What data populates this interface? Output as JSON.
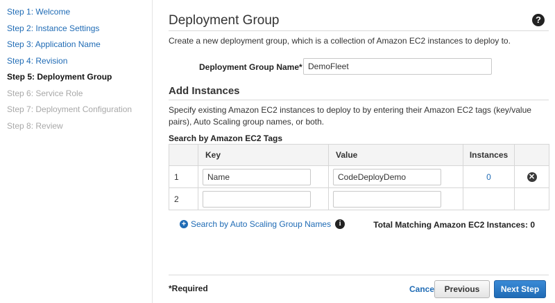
{
  "sidebar": {
    "steps": [
      {
        "label": "Step 1: Welcome"
      },
      {
        "label": "Step 2: Instance Settings"
      },
      {
        "label": "Step 3: Application Name"
      },
      {
        "label": "Step 4: Revision"
      },
      {
        "label": "Step 5: Deployment Group"
      },
      {
        "label": "Step 6: Service Role"
      },
      {
        "label": "Step 7: Deployment Configuration"
      },
      {
        "label": "Step 8: Review"
      }
    ]
  },
  "header": {
    "title": "Deployment Group",
    "help_icon": "question-circle-icon",
    "help_glyph": "?"
  },
  "intro": "Create a new deployment group, which is a collection of Amazon EC2 instances to deploy to.",
  "deployment_group": {
    "label": "Deployment Group Name*",
    "value": "DemoFleet"
  },
  "add_instances": {
    "title": "Add Instances",
    "description": "Specify existing Amazon EC2 instances to deploy to by entering their Amazon EC2 tags (key/value pairs), Auto Scaling group names, or both.",
    "tags_label": "Search by Amazon EC2 Tags",
    "table": {
      "columns": [
        "",
        "Key",
        "Value",
        "Instances",
        ""
      ],
      "rows": [
        {
          "num": "1",
          "key": "Name",
          "value": "CodeDeployDemo",
          "instances": "0",
          "remove_glyph": "✕"
        },
        {
          "num": "2",
          "key": "",
          "value": "",
          "instances": ""
        }
      ]
    },
    "asg_link": "Search by Auto Scaling Group Names",
    "plus_glyph": "+",
    "info_glyph": "i",
    "total": "Total Matching Amazon EC2 Instances: 0"
  },
  "footer": {
    "required": "*Required",
    "cancel": "Cancel",
    "previous": "Previous",
    "next": "Next Step"
  },
  "colors": {
    "link": "#1f6bb5",
    "primary_button": "#1f6bb5"
  }
}
